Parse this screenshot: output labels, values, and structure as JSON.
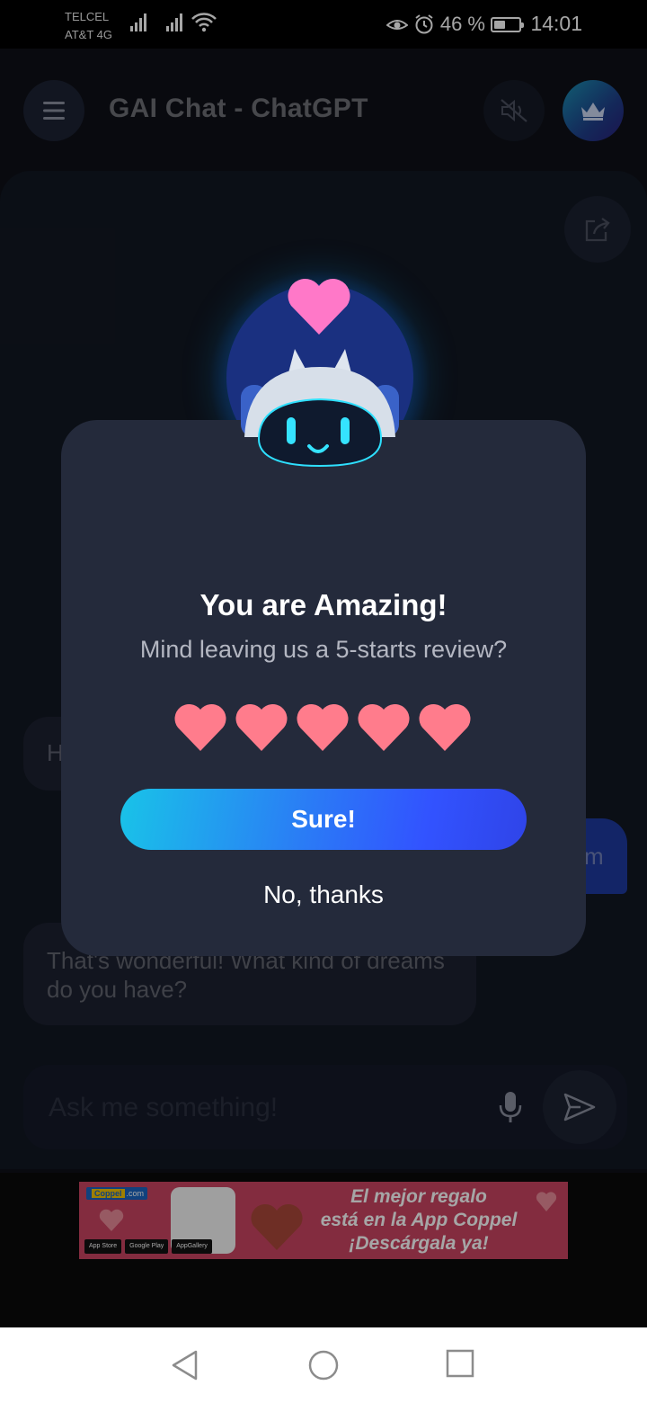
{
  "status_bar": {
    "carrier_1": "TELCEL",
    "carrier_2": "AT&T 4G",
    "battery_percent": "46 %",
    "battery_level": 0.46,
    "time": "14:01"
  },
  "header": {
    "title": "GAI Chat - ChatGPT",
    "icons": [
      "menu-icon",
      "mute-icon",
      "crown-icon"
    ]
  },
  "chat": {
    "messages": [
      {
        "role": "bot",
        "text": "H"
      },
      {
        "role": "user",
        "text": "m"
      },
      {
        "role": "bot",
        "text": "That's wonderful! What kind of dreams do you have?"
      }
    ],
    "input_placeholder": "Ask me something!"
  },
  "dialog": {
    "title": "You are Amazing!",
    "subtitle": "Mind leaving us a 5-starts review?",
    "rating_hearts": 5,
    "confirm_label": "Sure!",
    "dismiss_label": "No, thanks",
    "heart_color": "#ff7c8c",
    "accent_gradient": [
      "#19c3e8",
      "#3253ff"
    ]
  },
  "ad": {
    "brand": "Coppel",
    "brand_suffix": ".com",
    "line_1": "El mejor regalo",
    "line_2": "está en la App Coppel",
    "line_3": "¡Descárgala ya!",
    "stores": [
      "App Store",
      "Google Play",
      "AppGallery"
    ]
  },
  "nav_bar": {
    "icons": [
      "back-icon",
      "home-icon",
      "recents-icon"
    ]
  }
}
